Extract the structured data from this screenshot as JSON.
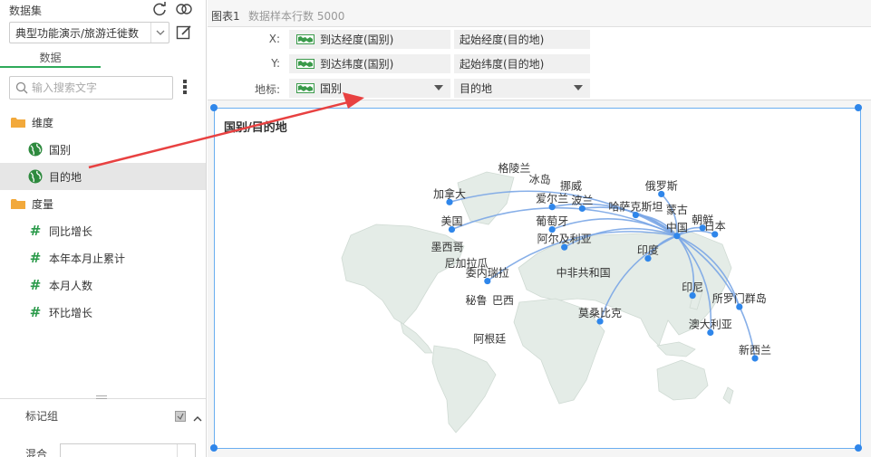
{
  "dataset": {
    "label": "数据集",
    "selected": "典型功能演示/旅游迁徙数",
    "tab": "数据",
    "search_placeholder": "输入搜索文字"
  },
  "dimensions": {
    "label": "维度",
    "items": [
      {
        "label": "国别"
      },
      {
        "label": "目的地"
      }
    ]
  },
  "measures": {
    "label": "度量",
    "items": [
      {
        "label": "同比增长"
      },
      {
        "label": "本年本月止累计"
      },
      {
        "label": "本月人数"
      },
      {
        "label": "环比增长"
      }
    ]
  },
  "marker_group": {
    "label": "标记组",
    "mix_label": "混合",
    "mix_value": ""
  },
  "topbar": {
    "chart_name": "图表1",
    "sample_text": "数据样本行数 5000"
  },
  "axes": {
    "x_label": "X:",
    "y_label": "Y:",
    "geo_label": "地标:",
    "x_fields": [
      "到达经度(国别)",
      "起始经度(目的地)"
    ],
    "y_fields": [
      "到达纬度(国别)",
      "起始纬度(目的地)"
    ],
    "geo_fields": [
      "国别",
      "目的地"
    ]
  },
  "chart": {
    "title": "国别/目的地",
    "colors": {
      "accent": "#2f86ea",
      "line": "#7aa6e6",
      "flag": "#3a9a4a",
      "map_fill": "#e4ece7"
    }
  },
  "chart_data": {
    "type": "flow-map",
    "title": "国别/目的地",
    "places": [
      {
        "name": "格陵兰",
        "lon": -42,
        "lat": 72
      },
      {
        "name": "冰岛",
        "lon": -19,
        "lat": 65
      },
      {
        "name": "挪威",
        "lon": 9,
        "lat": 61
      },
      {
        "name": "俄罗斯",
        "lon": 90,
        "lat": 61
      },
      {
        "name": "加拿大",
        "lon": -100,
        "lat": 56
      },
      {
        "name": "美国",
        "lon": -98,
        "lat": 39
      },
      {
        "name": "爱尔兰",
        "lon": -8,
        "lat": 53
      },
      {
        "name": "波兰",
        "lon": 19,
        "lat": 52
      },
      {
        "name": "哈萨克斯坦",
        "lon": 67,
        "lat": 48
      },
      {
        "name": "蒙古",
        "lon": 104,
        "lat": 46
      },
      {
        "name": "朝鲜",
        "lon": 127,
        "lat": 40
      },
      {
        "name": "中国",
        "lon": 104,
        "lat": 35
      },
      {
        "name": "葡萄牙",
        "lon": -8,
        "lat": 39
      },
      {
        "name": "日本",
        "lon": 138,
        "lat": 36
      },
      {
        "name": "阿尔及利亚",
        "lon": 3,
        "lat": 28
      },
      {
        "name": "墨西哥",
        "lon": -102,
        "lat": 23
      },
      {
        "name": "印度",
        "lon": 78,
        "lat": 21
      },
      {
        "name": "尼加拉瓜",
        "lon": -85,
        "lat": 13
      },
      {
        "name": "委内瑞拉",
        "lon": -66,
        "lat": 7
      },
      {
        "name": "中非共和国",
        "lon": 20,
        "lat": 7
      },
      {
        "name": "印尼",
        "lon": 118,
        "lat": -2
      },
      {
        "name": "巴西",
        "lon": -52,
        "lat": -10
      },
      {
        "name": "秘鲁",
        "lon": -76,
        "lat": -10
      },
      {
        "name": "所罗门群岛",
        "lon": 160,
        "lat": -9
      },
      {
        "name": "莫桑比克",
        "lon": 35,
        "lat": -18
      },
      {
        "name": "澳大利亚",
        "lon": 134,
        "lat": -25
      },
      {
        "name": "阿根廷",
        "lon": -64,
        "lat": -34
      },
      {
        "name": "新西兰",
        "lon": 174,
        "lat": -41
      }
    ],
    "flows": [
      {
        "from": "中国",
        "to": "加拿大"
      },
      {
        "from": "中国",
        "to": "美国"
      },
      {
        "from": "中国",
        "to": "爱尔兰"
      },
      {
        "from": "中国",
        "to": "波兰"
      },
      {
        "from": "中国",
        "to": "葡萄牙"
      },
      {
        "from": "中国",
        "to": "哈萨克斯坦"
      },
      {
        "from": "中国",
        "to": "俄罗斯"
      },
      {
        "from": "中国",
        "to": "朝鲜"
      },
      {
        "from": "中国",
        "to": "日本"
      },
      {
        "from": "中国",
        "to": "印度"
      },
      {
        "from": "中国",
        "to": "印尼"
      },
      {
        "from": "中国",
        "to": "澳大利亚"
      },
      {
        "from": "中国",
        "to": "新西兰"
      },
      {
        "from": "中国",
        "to": "阿尔及利亚"
      },
      {
        "from": "中国",
        "to": "莫桑比克"
      },
      {
        "from": "中国",
        "to": "委内瑞拉"
      },
      {
        "from": "中国",
        "to": "所罗门群岛"
      }
    ]
  }
}
